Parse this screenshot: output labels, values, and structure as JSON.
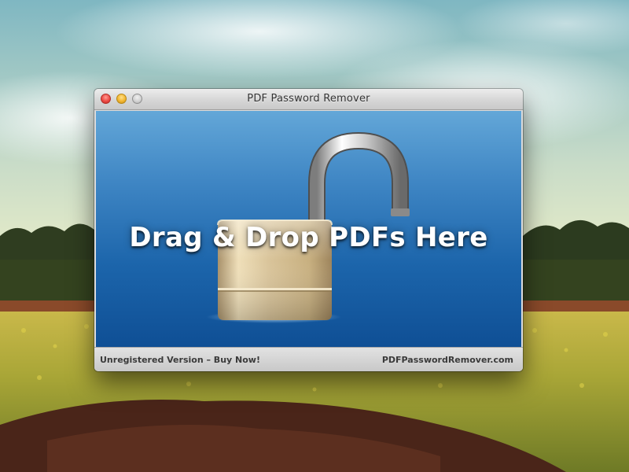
{
  "window": {
    "title": "PDF Password Remover"
  },
  "dropzone": {
    "label": "Drag & Drop PDFs Here",
    "icon": "unlocked-padlock-icon"
  },
  "statusbar": {
    "registration_link": "Unregistered Version – Buy Now!",
    "website_link": "PDFPasswordRemover.com"
  },
  "colors": {
    "dropzone_top": "#63a7d8",
    "dropzone_bottom": "#0f4f95",
    "close_button": "#ee4a44",
    "minimize_button": "#f2b631",
    "zoom_button": "#cfcfcf"
  }
}
